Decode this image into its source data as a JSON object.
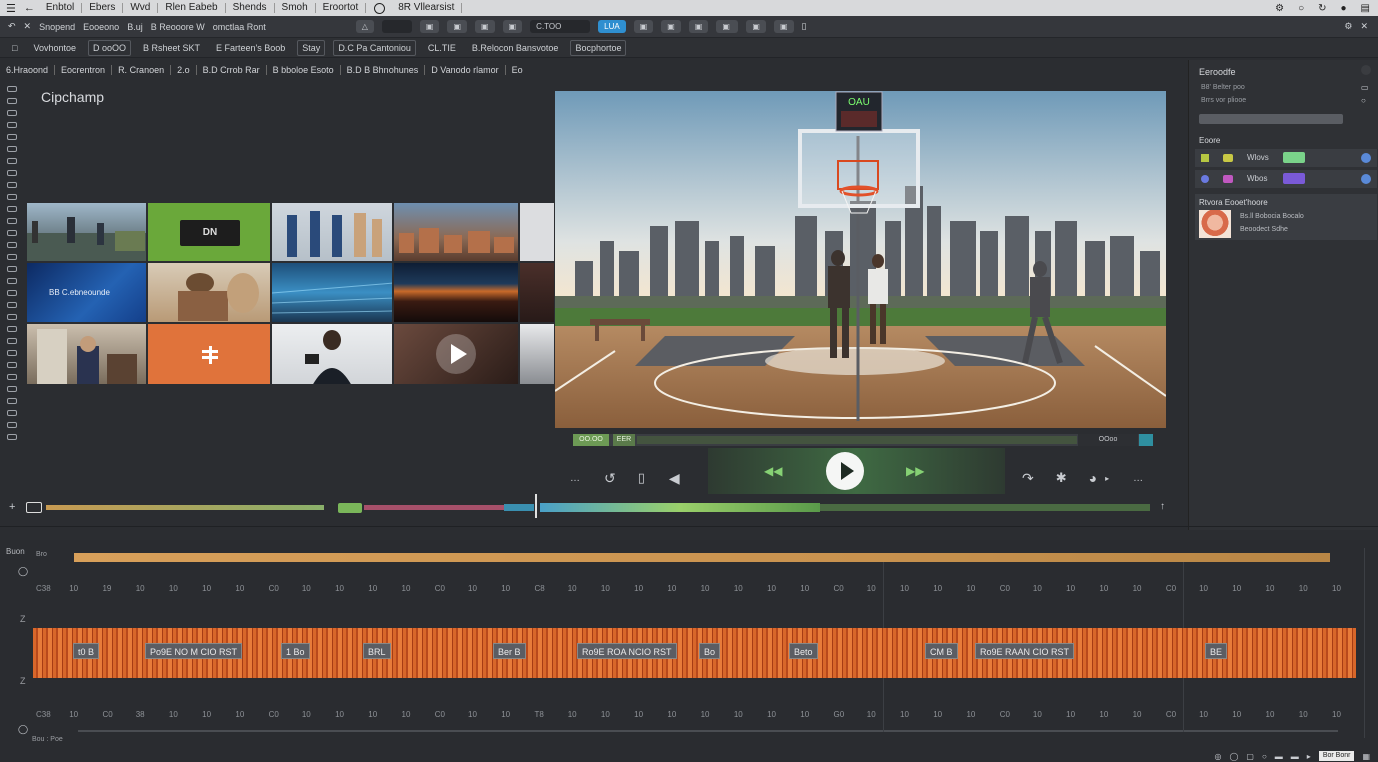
{
  "menubar": {
    "items": [
      "Enbtol",
      "Ebers",
      "Wvd",
      "Rlen Eabeb",
      "Shends",
      "Smoh",
      "Eroortot",
      "8R  Vllearsist"
    ]
  },
  "toolbar1": {
    "items": [
      "Snopend",
      "Eooeono",
      "B.uj",
      "B Reooore W",
      "omctlaa   Ront"
    ],
    "chip_dark_label": "C.TOO",
    "chip_blue_label": "LUA"
  },
  "toolbar2": {
    "items": [
      "Vovhontoe",
      "D ooOO",
      "B Rsheet SKT",
      "E Farteen's Boob",
      "Stay",
      "D.C Pa Cantoniou",
      "CL.TIE",
      "B.Relocon Bansvotoe",
      "Bocphortoe"
    ]
  },
  "toolbar3": {
    "items": [
      "6.Hraoond",
      "Eocrentron",
      "R. Cranoen",
      "2.o",
      "B.D Crrob Rar",
      "B bboloe  Esoto",
      "B.D B Bhnohunes",
      "D Vanodo rlamor",
      "Eo"
    ]
  },
  "media": {
    "title": "Cipchamp",
    "tile_labels": {
      "scoreboard": "DN",
      "blue_tile": "BB C.ebneounde"
    }
  },
  "preview": {
    "scoreboard_text": "OAU",
    "scrub_left_label": "OO.OO",
    "scrub_left_label2": "EER",
    "scrub_right_label": "OOoo"
  },
  "rightpanel": {
    "header": "Eeroodfe",
    "line1": "B8' Belter poo",
    "line2": "Brrs vor pliooe",
    "section2": "Eoore",
    "row1_label": "Wlovs",
    "row2_label": "Wbos",
    "asset_title": "Rtvora Eooet'hoore",
    "asset_line1": "Bs.ll Bobocia Bocalo",
    "asset_line2": "Beoodect Sdhe"
  },
  "timeline": {
    "header_label": "Buon",
    "header_label2": "Bro",
    "ticks_top": [
      "C38",
      "10",
      "19",
      "10",
      "10",
      "10",
      "10",
      "C0",
      "10",
      "10",
      "10",
      "10",
      "C0",
      "10",
      "10",
      "C8",
      "10",
      "10",
      "10",
      "10",
      "10",
      "10",
      "10",
      "10",
      "C0",
      "10",
      "10",
      "10",
      "10",
      "C0",
      "10",
      "10",
      "10",
      "10",
      "C0",
      "10",
      "10",
      "10",
      "10",
      "10"
    ],
    "ticks_bottom": [
      "C38",
      "10",
      "C0",
      "38",
      "10",
      "10",
      "10",
      "C0",
      "10",
      "10",
      "10",
      "10",
      "C0",
      "10",
      "10",
      "T8",
      "10",
      "10",
      "10",
      "10",
      "10",
      "10",
      "10",
      "10",
      "G0",
      "10",
      "10",
      "10",
      "10",
      "C0",
      "10",
      "10",
      "10",
      "10",
      "C0",
      "10",
      "10",
      "10",
      "10",
      "10"
    ],
    "clip_labels": [
      "t0 B",
      "Po9E NO M CIO RST",
      "1 Bo",
      "BRL",
      "Ber B",
      "Ro9E ROA NCIO RST",
      "Bo",
      "Beto",
      "CM B",
      "Ro9E RAAN CIO RST",
      "BE"
    ],
    "footer_label": "Bou : Poe"
  },
  "statusbar": {
    "chip": "Bor Bonr"
  },
  "colors": {
    "accent_blue": "#2f8fd0",
    "clip_orange": "#d8672a",
    "play_green": "#3f6a43"
  }
}
